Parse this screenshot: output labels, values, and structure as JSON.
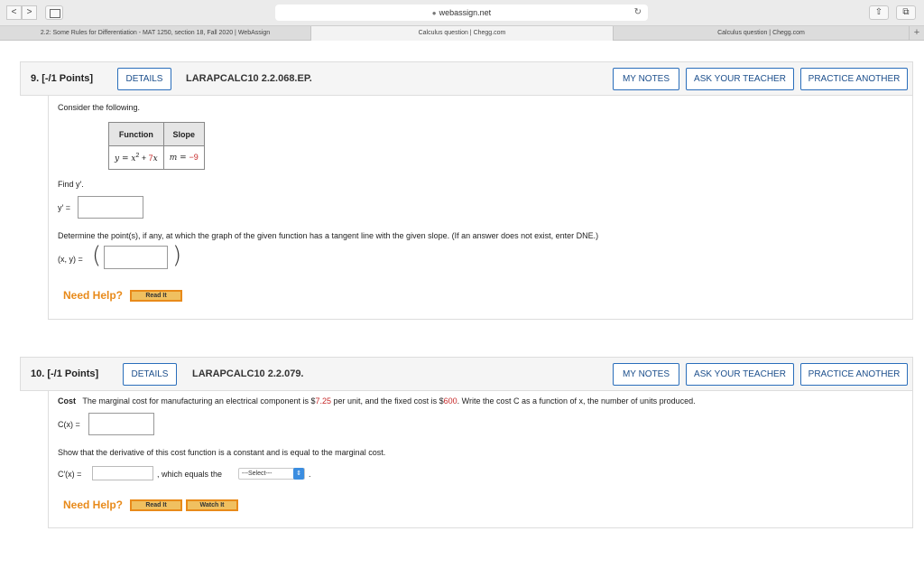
{
  "browser": {
    "back": "<",
    "forward": ">",
    "url": "webassign.net",
    "tabs": [
      "2.2: Some Rules for Differentiation - MAT 1250, section 18, Fall 2020 | WebAssign",
      "Calculus question | Chegg.com",
      "Calculus question | Chegg.com"
    ],
    "new_tab": "+"
  },
  "q9": {
    "number": "9.  [-/1 Points]",
    "details": "DETAILS",
    "code": "LARAPCALC10 2.2.068.EP.",
    "my_notes": "MY NOTES",
    "ask_teacher": "ASK YOUR TEACHER",
    "practice": "PRACTICE ANOTHER",
    "intro": "Consider the following.",
    "table": {
      "headers": [
        "Function",
        "Slope"
      ],
      "function_prefix": "y = x",
      "function_exp": "2",
      "function_plus": " + ",
      "function_coef": "7",
      "function_var": "x",
      "slope_prefix": "m = ",
      "slope_value": "−9"
    },
    "find": "Find y′.",
    "yprime_label": "y′ =",
    "determine": "Determine the point(s), if any, at which the graph of the given function has a tangent line with the given slope. (If an answer does not exist, enter DNE.)",
    "xy_label": "(x, y) =",
    "need_help": "Need Help?",
    "read_it": "Read It"
  },
  "q10": {
    "number": "10.  [-/1 Points]",
    "details": "DETAILS",
    "code": "LARAPCALC10 2.2.079.",
    "my_notes": "MY NOTES",
    "ask_teacher": "ASK YOUR TEACHER",
    "practice": "PRACTICE ANOTHER",
    "cost_label": "Cost",
    "cost_text_1": "The marginal cost for manufacturing an electrical component is $",
    "cost_value_1": "7.25",
    "cost_text_2": " per unit, and the fixed cost is $",
    "cost_value_2": "600",
    "cost_text_3": ". Write the cost C as a function of x, the number of units produced.",
    "cx_label": "C(x) =",
    "show_text": "Show that the derivative of this cost function is a constant and is equal to the marginal cost.",
    "cprime_label": "C′(x) =",
    "which_equals": ", which equals the",
    "select_value": "---Select---",
    "period": ".",
    "need_help": "Need Help?",
    "read_it": "Read It",
    "watch_it": "Watch It"
  },
  "icons": [
    "lock-icon",
    "reload-icon",
    "share-icon",
    "tabs-icon",
    "sidebar-icon"
  ]
}
